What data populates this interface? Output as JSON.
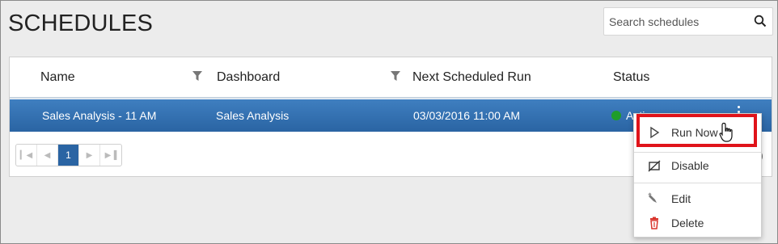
{
  "page": {
    "title": "SCHEDULES"
  },
  "search": {
    "placeholder": "Search schedules"
  },
  "grid": {
    "columns": [
      "Name",
      "Dashboard",
      "Next Scheduled Run",
      "Status"
    ],
    "rows": [
      {
        "name": "Sales Analysis - 11 AM",
        "dashboard": "Sales Analysis",
        "next_run": "03/03/2016 11:00 AM",
        "status": "Active"
      }
    ]
  },
  "pager": {
    "current_page": "1",
    "info_fragment": "s)"
  },
  "context_menu": {
    "items": [
      {
        "label": "Run Now",
        "icon": "play-icon"
      },
      {
        "label": "Disable",
        "icon": "disable-icon"
      },
      {
        "label": "Edit",
        "icon": "edit-icon"
      },
      {
        "label": "Delete",
        "icon": "trash-icon"
      }
    ]
  },
  "colors": {
    "row_selected": "#2a64a3",
    "status_active": "#1f9d2a",
    "highlight_border": "#e0131a",
    "delete_icon": "#d9342b"
  }
}
